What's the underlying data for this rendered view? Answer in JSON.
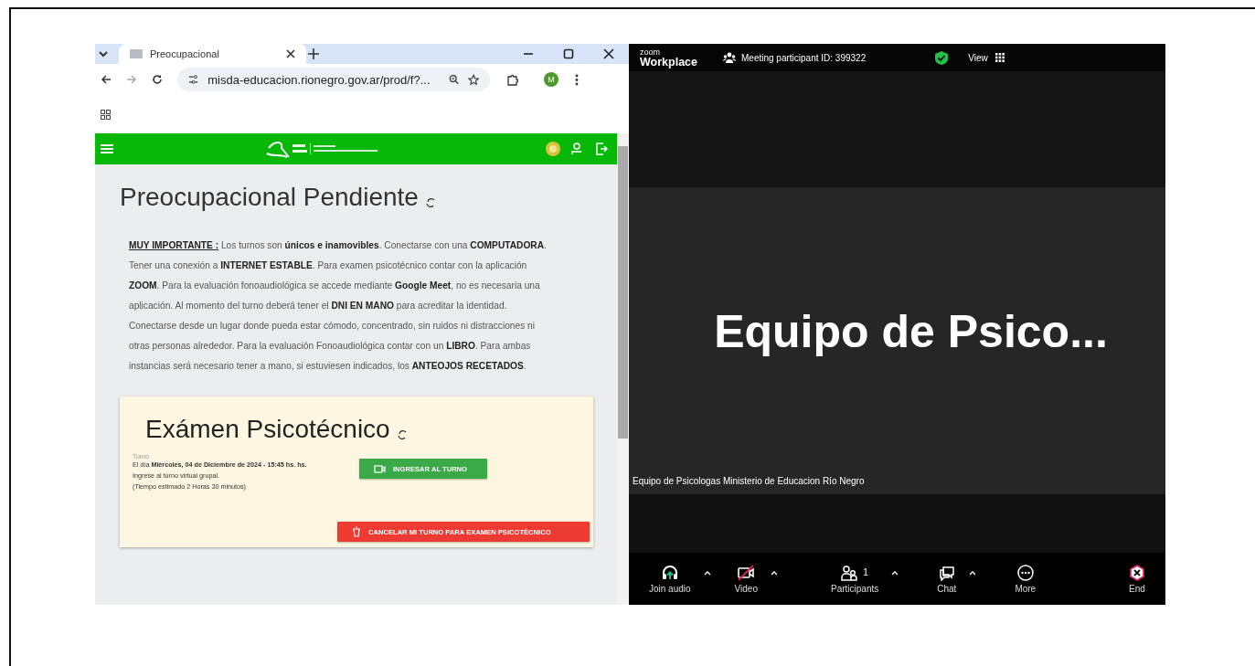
{
  "browser": {
    "tab": {
      "title": "Preocupacional"
    },
    "url": "misda-educacion.rionegro.gov.ar/prod/f?...",
    "profile": "M",
    "page": {
      "title": "Preocupacional Pendiente",
      "notice": "**MUY IMPORTANTE :** Los turnos son **únicos e inamovibles**. Conectarse con una **COMPUTADORA**. Tener una conexión a **INTERNET ESTABLE**. Para examen psicotécnico contar con la aplicación **ZOOM**. Para la evaluación fonoaudiológica se accede mediante **Google Meet**, no es necesaria una aplicación. Al momento del turno deberá tener el **DNI EN MANO** para acreditar la identidad. Conectarse desde un lugar donde pueda estar cómodo, concentrado, sin ruidos ni distracciones ni otras personas alrededor. Para la evaluación Fonoaudiológica contar con un **LIBRO**. Para ambas instancias será necesario tener a mano, si estuviesen indicados, los **ANTEOJOS RECETADOS**.",
      "card": {
        "title": "Exámen Psicotécnico",
        "label": "Turno",
        "lines": [
          "El día **Miércoles, 04 de Diciembre de 2024 - 15:45 hs. hs.**",
          "Ingrese al turno virtual grupal.",
          "(Tiempo estimado 2 Horas 30 minutos)"
        ],
        "join_button": "INGRESAR AL TURNO",
        "cancel_button": "CANCELAR MI TURNO PARA EXAMEN PSICOTÉCNICO"
      }
    }
  },
  "zoom": {
    "brand": "zoom",
    "product": "Workplace",
    "meeting_id": "Meeting participant ID: 399322",
    "view": "View",
    "speaker": "Equipo de Psico...",
    "name_label": "Equipo de Psicologas Ministerio de Educacion Río Negro",
    "toolbar": [
      {
        "kind": "audio",
        "label": "Join audio",
        "caret": true,
        "off": false
      },
      {
        "kind": "video",
        "label": "Video",
        "caret": true,
        "off": true
      },
      {
        "kind": "participants",
        "label": "Participants",
        "count": "1",
        "caret": true,
        "off": false
      },
      {
        "kind": "chat",
        "label": "Chat",
        "caret": true,
        "off": false
      },
      {
        "kind": "more",
        "label": "More",
        "caret": false,
        "off": false
      },
      {
        "kind": "end",
        "label": "End",
        "caret": false,
        "off": false
      }
    ]
  }
}
